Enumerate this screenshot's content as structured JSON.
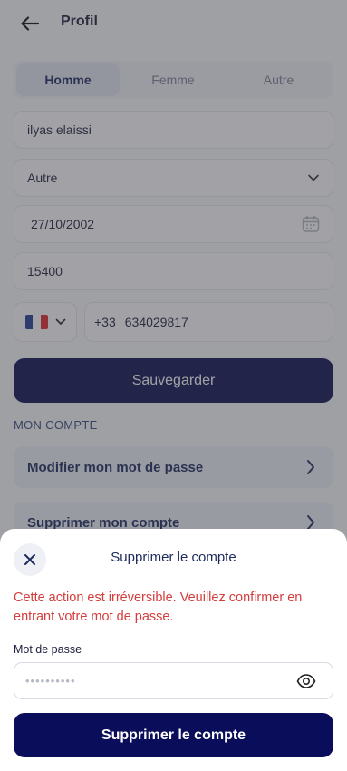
{
  "header": {
    "title": "Profil"
  },
  "gender": {
    "options": [
      "Homme",
      "Femme",
      "Autre"
    ],
    "selected": "Homme"
  },
  "form": {
    "name": "ilyas elaissi",
    "status_select": "Autre",
    "birthdate": "27/10/2002",
    "postal_code": "15400",
    "phone": {
      "country": "FR",
      "dial_code": "+33",
      "number": "634029817"
    }
  },
  "save_label": "Sauvegarder",
  "account": {
    "section_title": "MON COMPTE",
    "items": [
      "Modifier mon mot de passe",
      "Supprimer mon compte"
    ]
  },
  "dialog": {
    "title": "Supprimer le compte",
    "warning": "Cette action est irréversible. Veuillez confirmer en entrant votre mot de passe.",
    "password_label": "Mot de passe",
    "password_placeholder": "••••••••••",
    "confirm_label": "Supprimer le compte"
  },
  "colors": {
    "primary": "#0a0e5a",
    "danger": "#d53c3c",
    "flag_blue": "#1f3a93",
    "flag_white": "#ffffff",
    "flag_red": "#e1262d"
  },
  "icons": [
    "back-arrow-icon",
    "chevron-down-icon",
    "calendar-icon",
    "chevron-right-icon",
    "close-icon",
    "eye-icon"
  ]
}
